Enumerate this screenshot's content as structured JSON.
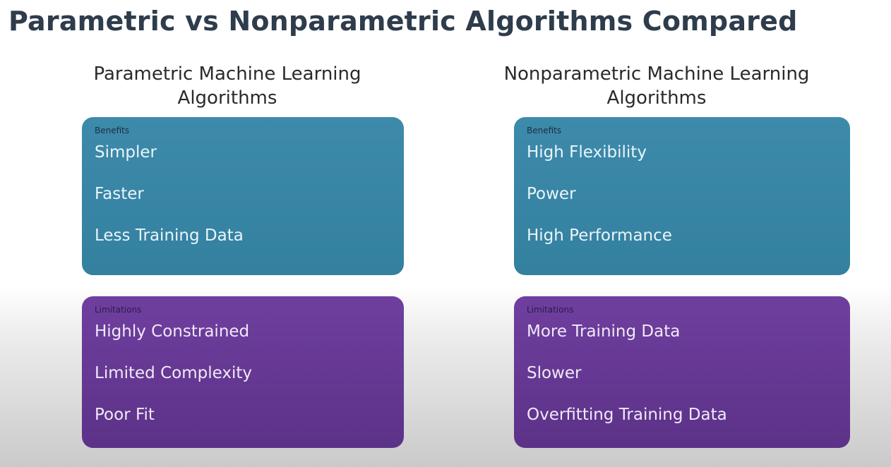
{
  "title": "Parametric vs Nonparametric Algorithms Compared",
  "columns": [
    {
      "heading_line1": "Parametric Machine Learning",
      "heading_line2": "Algorithms",
      "benefits": {
        "label": "Benefits",
        "items": [
          "Simpler",
          "Faster",
          "Less Training Data"
        ]
      },
      "limitations": {
        "label": "Limitations",
        "items": [
          "Highly Constrained",
          "Limited Complexity",
          "Poor Fit"
        ]
      }
    },
    {
      "heading_line1": "Nonparametric Machine Learning",
      "heading_line2": "Algorithms",
      "benefits": {
        "label": "Benefits",
        "items": [
          "High Flexibility",
          "Power",
          "High Performance"
        ]
      },
      "limitations": {
        "label": "Limitations",
        "items": [
          "More Training Data",
          "Slower",
          "Overfitting Training Data"
        ]
      }
    }
  ],
  "colors": {
    "title": "#2e3c4c",
    "benefits_box": "#3a87a8",
    "limitations_box": "#663999"
  }
}
